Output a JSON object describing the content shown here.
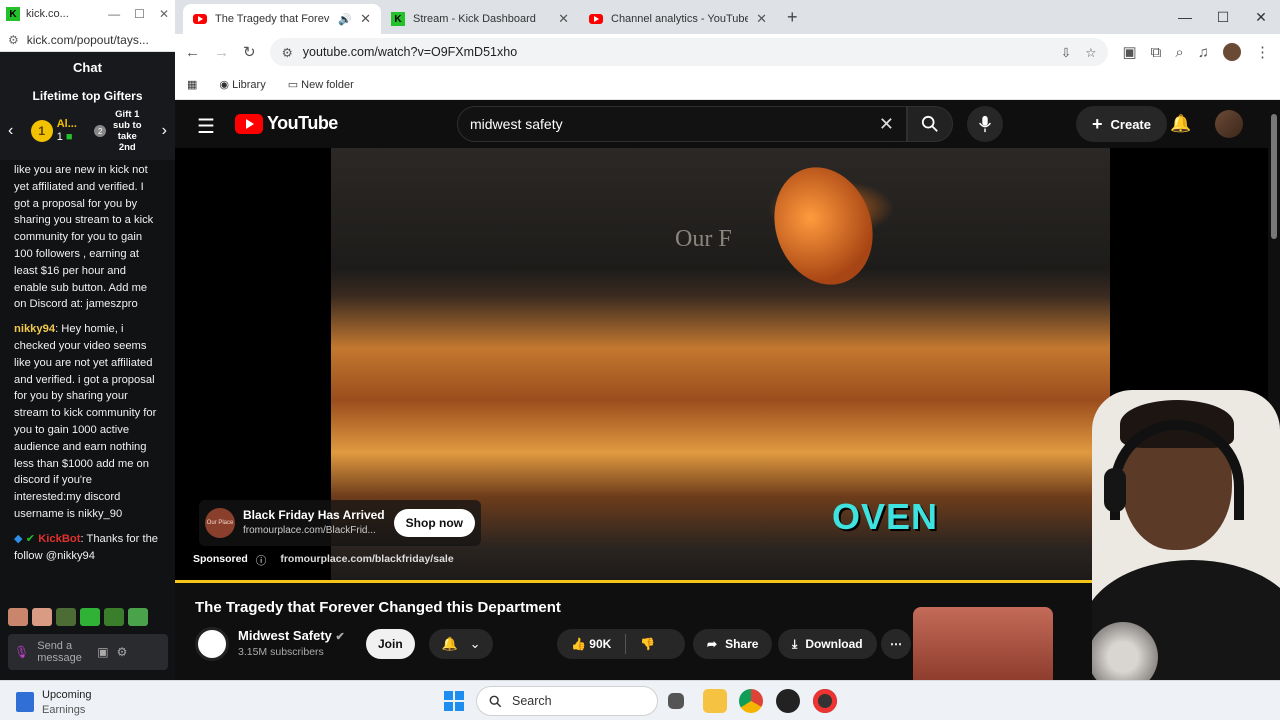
{
  "kick_popout": {
    "window_title": "kick.co...",
    "url": "kick.com/popout/tays...",
    "chat_header": "Chat",
    "gifters_title": "Lifetime top Gifters",
    "top_gifter": {
      "rank": "1",
      "name": "Al...",
      "count": "1"
    },
    "gift_cta": "Gift 1 sub to take 2nd",
    "gift_rank": "2",
    "messages": [
      {
        "user": "",
        "text": "like you are new in kick not yet affiliated and verified. I got a proposal for you by sharing you stream to a kick community for you to gain 100 followers , earning at least $16 per hour and enable sub button. Add me on Discord at: jameszpro"
      },
      {
        "user": "nikky94",
        "text": ": Hey homie, i checked your video seems like you are not yet affiliated and verified. i got a proposal for you by sharing your stream to kick community for you to gain 1000 active audience and earn nothing less than $1000 add me on discord if you're interested:my discord username is nikky_90"
      },
      {
        "user": "KickBot",
        "text": ": Thanks for the follow @nikky94"
      }
    ],
    "input_placeholder": "Send a message"
  },
  "browser": {
    "tabs": [
      {
        "title": "The Tragedy that Forever Ch",
        "active": true
      },
      {
        "title": "Stream - Kick Dashboard",
        "active": false
      },
      {
        "title": "Channel analytics - YouTube St",
        "active": false
      }
    ],
    "url": "youtube.com/watch?v=O9FXmD51xho",
    "bookmarks": [
      "Library",
      "New folder"
    ]
  },
  "youtube": {
    "logo": "YouTube",
    "search_query": "midwest safety",
    "create_label": "Create",
    "video": {
      "caption": "OVEN",
      "overlay_text": "Our F",
      "progress": 1.0
    },
    "ad": {
      "logo_text": "Our Place",
      "title": "Black Friday Has Arrived",
      "domain": "fromourplace.com/BlackFrid...",
      "cta": "Shop now",
      "sponsored": "Sponsored",
      "link": "fromourplace.com/blackfriday/sale"
    },
    "title": "The Tragedy that Forever Changed this Department",
    "channel": {
      "name": "Midwest Safety",
      "subs": "3.15M subscribers"
    },
    "join_label": "Join",
    "likes": "90K",
    "share_label": "Share",
    "download_label": "Download"
  },
  "taskbar": {
    "weather_title": "Upcoming",
    "weather_sub": "Earnings",
    "search_label": "Search"
  },
  "colors": {
    "youtube_red": "#ff0000",
    "kick_green": "#23c22b",
    "caption_cyan": "#3ee3e0",
    "progress": "#f5c518"
  }
}
